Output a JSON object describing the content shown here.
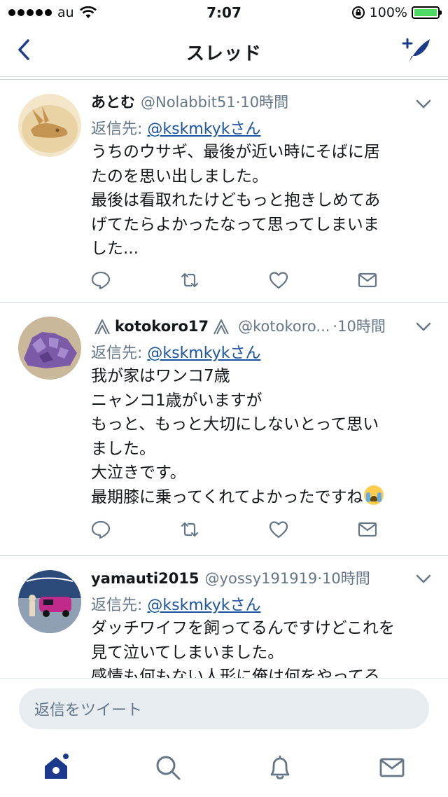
{
  "status_bar": {
    "carrier": "au",
    "time": "7:07",
    "battery": "100%"
  },
  "nav": {
    "title": "スレッド"
  },
  "tweets": [
    {
      "display_name": "あとむ",
      "handle": "@Nolabbit51",
      "separator": "·",
      "time": "10時間",
      "reply_prefix": "返信先: ",
      "reply_to": "@kskmkykさん",
      "lines": [
        "うちのウサギ、最後が近い時にそばに居",
        "たのを思い出しました。",
        "最後は看取れたけどもっと抱きしめてあ",
        "げてたらよかったなって思ってしまいま",
        "した..."
      ]
    },
    {
      "display_name": "kotokoro17",
      "handle": "@kotokoro...",
      "separator": "·",
      "time": "10時間",
      "reply_prefix": "返信先: ",
      "reply_to": "@kskmkykさん",
      "lines": [
        "我が家はワンコ7歳",
        "ニャンコ1歳がいますが",
        "もっと、もっと大切にしないとって思い",
        "ました。",
        "大泣きです。",
        "最期膝に乗ってくれてよかったですね"
      ],
      "emoji": "crying-face"
    },
    {
      "display_name": "yamauti2015",
      "handle": "@yossy191919",
      "separator": "·",
      "time": "10時間",
      "reply_prefix": "返信先: ",
      "reply_to": "@kskmkykさん",
      "lines": [
        "ダッチワイフを飼ってるんですけどこれを",
        "見て泣いてしまいました。",
        "感情も何もない人形に俺は何をやってる"
      ]
    }
  ],
  "reply_bar": {
    "placeholder": "返信をツイート"
  },
  "tabs": [
    "home-icon",
    "search-icon",
    "notifications-icon",
    "messages-icon"
  ],
  "colors": {
    "accent": "#1b3a8c",
    "link": "#1b55a0",
    "secondary_text": "#657786",
    "battery_fill": "#4cd964"
  }
}
